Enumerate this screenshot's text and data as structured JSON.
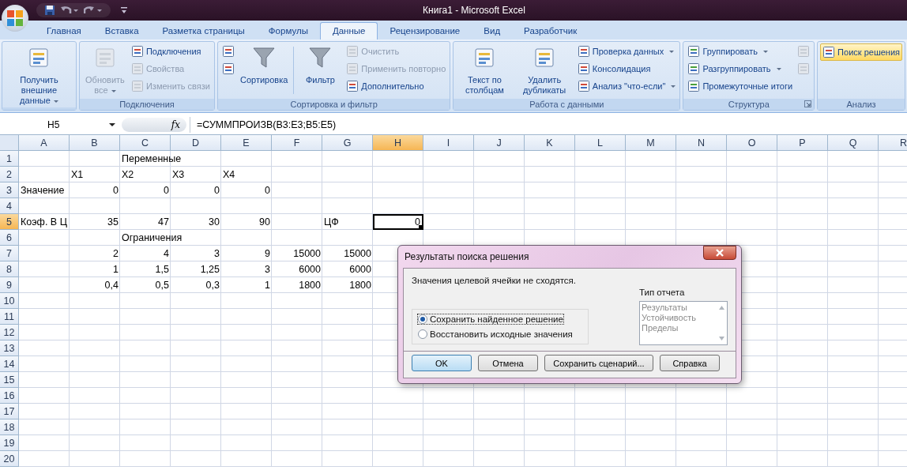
{
  "window": {
    "title": "Книга1 - Microsoft Excel"
  },
  "tabs": [
    {
      "label": "Главная",
      "selected": false
    },
    {
      "label": "Вставка",
      "selected": false
    },
    {
      "label": "Разметка страницы",
      "selected": false
    },
    {
      "label": "Формулы",
      "selected": false
    },
    {
      "label": "Данные",
      "selected": true
    },
    {
      "label": "Рецензирование",
      "selected": false
    },
    {
      "label": "Вид",
      "selected": false
    },
    {
      "label": "Разработчик",
      "selected": false
    }
  ],
  "ribbon_groups": [
    {
      "columns": [
        {
          "kind": "large",
          "label": "Получить внешние данные",
          "disabled": false,
          "dropdown": true
        }
      ]
    },
    {
      "label": "Подключения",
      "columns": [
        {
          "kind": "large",
          "label": "Обновить все",
          "disabled": true,
          "dropdown": true
        },
        {
          "kind": "stack",
          "items": [
            {
              "label": "Подключения",
              "disabled": false,
              "dropdown": false
            },
            {
              "label": "Свойства",
              "disabled": true,
              "dropdown": false
            },
            {
              "label": "Изменить связи",
              "disabled": true,
              "dropdown": false
            }
          ]
        }
      ]
    },
    {
      "label": "Сортировка и фильтр",
      "columns": [
        {
          "kind": "stack",
          "items": [
            {
              "disabled": false
            },
            {
              "disabled": false
            }
          ]
        },
        {
          "kind": "large",
          "label": "Сортировка",
          "disabled": false,
          "dropdown": false
        },
        {
          "kind": "separator"
        },
        {
          "kind": "large",
          "label": "Фильтр",
          "disabled": false,
          "dropdown": false
        },
        {
          "kind": "stack",
          "items": [
            {
              "label": "Очистить",
              "disabled": true,
              "dropdown": false
            },
            {
              "label": "Применить повторно",
              "disabled": true,
              "dropdown": false
            },
            {
              "label": "Дополнительно",
              "disabled": false,
              "dropdown": false
            }
          ]
        }
      ]
    },
    {
      "label": "Работа с данными",
      "columns": [
        {
          "kind": "large",
          "label": "Текст по столбцам",
          "disabled": false,
          "dropdown": false
        },
        {
          "kind": "large",
          "label": "Удалить дубликаты",
          "disabled": false,
          "dropdown": false
        },
        {
          "kind": "stack",
          "items": [
            {
              "label": "Проверка данных",
              "disabled": false,
              "dropdown": true
            },
            {
              "label": "Консолидация",
              "disabled": false,
              "dropdown": false
            },
            {
              "label": "Анализ \"что-если\"",
              "disabled": false,
              "dropdown": true
            }
          ]
        }
      ]
    },
    {
      "label": "Структура",
      "launcher": true,
      "columns": [
        {
          "kind": "stack",
          "items": [
            {
              "label": "Группировать",
              "disabled": false,
              "dropdown": true
            },
            {
              "label": "Разгруппировать",
              "disabled": false,
              "dropdown": true
            },
            {
              "label": "Промежуточные итоги",
              "disabled": false,
              "dropdown": false
            }
          ]
        },
        {
          "kind": "stack",
          "items": [
            {
              "disabled": true
            },
            {
              "disabled": true
            }
          ]
        }
      ]
    },
    {
      "label": "Анализ",
      "columns": [
        {
          "kind": "stack",
          "items": [
            {
              "label": "Поиск решения",
              "disabled": false,
              "dropdown": false,
              "highlighted": true
            }
          ]
        }
      ]
    }
  ],
  "formula_bar": {
    "name_box": "H5",
    "function_label": "fx",
    "formula": "=СУММПРОИЗВ(B3:E3;B5:E5)"
  },
  "columns": [
    {
      "label": "A",
      "selected": false
    },
    {
      "label": "B",
      "selected": false
    },
    {
      "label": "C",
      "selected": false
    },
    {
      "label": "D",
      "selected": false
    },
    {
      "label": "E",
      "selected": false
    },
    {
      "label": "F",
      "selected": false
    },
    {
      "label": "G",
      "selected": false
    },
    {
      "label": "H",
      "selected": true
    },
    {
      "label": "I",
      "selected": false
    },
    {
      "label": "J",
      "selected": false
    },
    {
      "label": "K",
      "selected": false
    },
    {
      "label": "L",
      "selected": false
    },
    {
      "label": "M",
      "selected": false
    },
    {
      "label": "N",
      "selected": false
    },
    {
      "label": "O",
      "selected": false
    },
    {
      "label": "P",
      "selected": false
    },
    {
      "label": "Q",
      "selected": false
    },
    {
      "label": "R",
      "selected": false
    }
  ],
  "rows": [
    {
      "label": "1",
      "selected": false,
      "cells": [
        null,
        null,
        {
          "text": "Переменные",
          "kind": "text"
        }
      ]
    },
    {
      "label": "2",
      "selected": false,
      "cells": [
        null,
        {
          "text": "X1",
          "kind": "text"
        },
        {
          "text": "X2",
          "kind": "text"
        },
        {
          "text": "X3",
          "kind": "text"
        },
        {
          "text": "X4",
          "kind": "text"
        }
      ]
    },
    {
      "label": "3",
      "selected": false,
      "cells": [
        {
          "text": "Значение",
          "kind": "text"
        },
        {
          "text": "0",
          "kind": "number"
        },
        {
          "text": "0",
          "kind": "number"
        },
        {
          "text": "0",
          "kind": "number"
        },
        {
          "text": "0",
          "kind": "number"
        }
      ]
    },
    {
      "label": "4",
      "selected": false,
      "cells": []
    },
    {
      "label": "5",
      "selected": true,
      "cells": [
        {
          "text": "Коэф. В Ц",
          "kind": "text"
        },
        {
          "text": "35",
          "kind": "number"
        },
        {
          "text": "47",
          "kind": "number"
        },
        {
          "text": "30",
          "kind": "number"
        },
        {
          "text": "90",
          "kind": "number"
        },
        null,
        {
          "text": "ЦФ",
          "kind": "text"
        },
        {
          "text": "0",
          "kind": "number"
        }
      ]
    },
    {
      "label": "6",
      "selected": false,
      "cells": [
        null,
        null,
        {
          "text": "Ограничения",
          "kind": "text"
        }
      ]
    },
    {
      "label": "7",
      "selected": false,
      "cells": [
        null,
        {
          "text": "2",
          "kind": "number"
        },
        {
          "text": "4",
          "kind": "number"
        },
        {
          "text": "3",
          "kind": "number"
        },
        {
          "text": "9",
          "kind": "number"
        },
        {
          "text": "15000",
          "kind": "number"
        },
        {
          "text": "15000",
          "kind": "number"
        }
      ]
    },
    {
      "label": "8",
      "selected": false,
      "cells": [
        null,
        {
          "text": "1",
          "kind": "number"
        },
        {
          "text": "1,5",
          "kind": "number"
        },
        {
          "text": "1,25",
          "kind": "number"
        },
        {
          "text": "3",
          "kind": "number"
        },
        {
          "text": "6000",
          "kind": "number"
        },
        {
          "text": "6000",
          "kind": "number"
        }
      ]
    },
    {
      "label": "9",
      "selected": false,
      "cells": [
        null,
        {
          "text": "0,4",
          "kind": "number"
        },
        {
          "text": "0,5",
          "kind": "number"
        },
        {
          "text": "0,3",
          "kind": "number"
        },
        {
          "text": "1",
          "kind": "number"
        },
        {
          "text": "1800",
          "kind": "number"
        },
        {
          "text": "1800",
          "kind": "number"
        }
      ]
    },
    {
      "label": "10",
      "selected": false,
      "cells": []
    },
    {
      "label": "11",
      "selected": false,
      "cells": []
    },
    {
      "label": "12",
      "selected": false,
      "cells": []
    },
    {
      "label": "13",
      "selected": false,
      "cells": []
    },
    {
      "label": "14",
      "selected": false,
      "cells": []
    },
    {
      "label": "15",
      "selected": false,
      "cells": []
    },
    {
      "label": "16",
      "selected": false,
      "cells": []
    },
    {
      "label": "17",
      "selected": false,
      "cells": []
    },
    {
      "label": "18",
      "selected": false,
      "cells": []
    },
    {
      "label": "19",
      "selected": false,
      "cells": []
    },
    {
      "label": "20",
      "selected": false,
      "cells": []
    }
  ],
  "dialog": {
    "title": "Результаты поиска решения",
    "message": "Значения целевой ячейки не сходятся.",
    "options": [
      {
        "label": "Сохранить найденное решение",
        "selected": true
      },
      {
        "label": "Восстановить исходные значения",
        "selected": false
      }
    ],
    "report_type": {
      "label": "Тип отчета",
      "items": [
        {
          "label": "Результаты",
          "disabled": true
        },
        {
          "label": "Устойчивость",
          "disabled": true
        },
        {
          "label": "Пределы",
          "disabled": true
        }
      ]
    },
    "buttons": [
      {
        "label": "OK",
        "default": true
      },
      {
        "label": "Отмена",
        "default": false
      },
      {
        "label": "Сохранить сценарий...",
        "default": false
      },
      {
        "label": "Справка",
        "default": false
      }
    ]
  }
}
